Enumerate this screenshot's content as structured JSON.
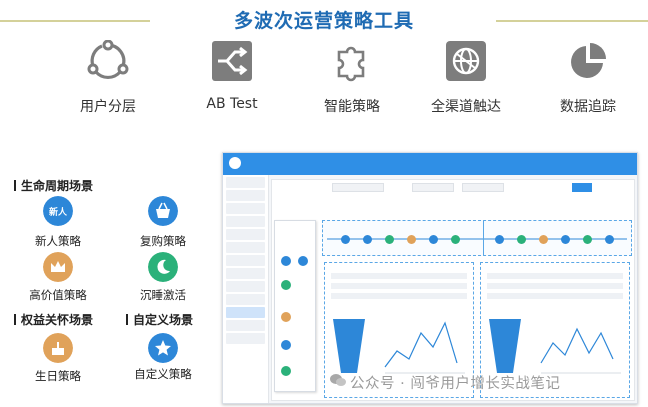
{
  "header": {
    "title": "多波次运营策略工具"
  },
  "features": [
    {
      "label": "用户分层",
      "icon": "user-segmentation-icon"
    },
    {
      "label": "AB Test",
      "icon": "ab-test-icon"
    },
    {
      "label": "智能策略",
      "icon": "puzzle-icon"
    },
    {
      "label": "全渠道触达",
      "icon": "omnichannel-icon"
    },
    {
      "label": "数据追踪",
      "icon": "pie-chart-icon"
    }
  ],
  "sections": {
    "lifecycle": "生命周期场景",
    "benefit": "权益关怀场景",
    "custom": "自定义场景"
  },
  "strategies": [
    {
      "label": "新人策略",
      "icon": "new-user-icon",
      "color": "#2d87d8"
    },
    {
      "label": "复购策略",
      "icon": "basket-icon",
      "color": "#2d87d8"
    },
    {
      "label": "高价值策略",
      "icon": "crown-icon",
      "color": "#e0a25a"
    },
    {
      "label": "沉睡激活",
      "icon": "moon-icon",
      "color": "#2bb17a"
    },
    {
      "label": "生日策略",
      "icon": "cake-icon",
      "color": "#e0a25a"
    },
    {
      "label": "自定义策略",
      "icon": "star-icon",
      "color": "#2d87d8"
    }
  ],
  "watermark": {
    "text": "公众号 · 闯爷用户增长实战笔记"
  },
  "colors": {
    "accent": "#1f6bb3",
    "icon_gray": "#7d7d7d",
    "platform_blue": "#2f8fe6"
  }
}
